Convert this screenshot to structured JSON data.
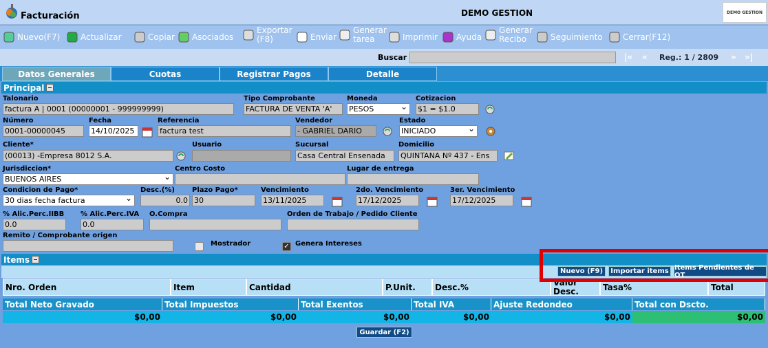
{
  "app": {
    "title": "Facturación",
    "company": "DEMO GESTION",
    "brand_logo_text": "DEMO GESTION"
  },
  "toolbar": [
    {
      "label": "Nuevo(F7)",
      "icon": "new-doc-icon"
    },
    {
      "label": "Actualizar",
      "icon": "refresh-money-icon"
    },
    {
      "label": "Copiar",
      "icon": "copy-icon"
    },
    {
      "label": "Asociados",
      "icon": "associated-icon"
    },
    {
      "label": "Exportar (F8)",
      "icon": "export-icon"
    },
    {
      "label": "Enviar",
      "icon": "send-icon"
    },
    {
      "label": "Generar tarea",
      "icon": "task-icon"
    },
    {
      "label": "Imprimir",
      "icon": "print-icon"
    },
    {
      "label": "Ayuda",
      "icon": "help-icon"
    },
    {
      "label": "Generar Recibo",
      "icon": "receipt-icon"
    },
    {
      "label": "Seguimiento",
      "icon": "tracking-icon"
    },
    {
      "label": "Cerrar(F12)",
      "icon": "close-icon"
    }
  ],
  "search": {
    "label": "Buscar",
    "value": ""
  },
  "pager": {
    "first": "|«",
    "prev": "«",
    "record": "Reg.: 1 / 2809",
    "next": "»",
    "last": "»|"
  },
  "tabs": [
    "Datos Generales",
    "Cuotas",
    "Registrar Pagos",
    "Detalle"
  ],
  "sections": {
    "principal": "Principal",
    "items": "Items"
  },
  "form": {
    "talonario": {
      "label": "Talonario",
      "value": "factura A | 0001 (00000001 - 999999999)"
    },
    "tipo_comprobante": {
      "label": "Tipo Comprobante",
      "value": "FACTURA DE VENTA 'A'"
    },
    "moneda": {
      "label": "Moneda",
      "value": "PESOS"
    },
    "cotizacion": {
      "label": "Cotizacion",
      "value": "$1 = $1.0"
    },
    "numero": {
      "label": "Número",
      "value": "0001-00000045"
    },
    "fecha": {
      "label": "Fecha",
      "value": "14/10/2025"
    },
    "referencia": {
      "label": "Referencia",
      "value": "factura test"
    },
    "vendedor": {
      "label": "Vendedor",
      "value": "- GABRIEL DARIO"
    },
    "estado": {
      "label": "Estado",
      "value": "INICIADO"
    },
    "cliente": {
      "label": "Cliente*",
      "value": "(00013) -Empresa 8012 S.A."
    },
    "usuario": {
      "label": "Usuario",
      "value": ""
    },
    "sucursal": {
      "label": "Sucursal",
      "value": "Casa Central Ensenada"
    },
    "domicilio": {
      "label": "Domicilio",
      "value": "QUINTANA  Nº 437 - Ens"
    },
    "jurisdiccion": {
      "label": "Jurisdiccion*",
      "value": "BUENOS AIRES"
    },
    "centro_costo": {
      "label": "Centro Costo",
      "value": ""
    },
    "lugar_entrega": {
      "label": "Lugar de entrega",
      "value": ""
    },
    "condicion_pago": {
      "label": "Condicion de Pago*",
      "value": "30 dias fecha factura"
    },
    "desc": {
      "label": "Desc.(%)",
      "value": "0.0"
    },
    "plazo_pago": {
      "label": "Plazo Pago*",
      "value": "30"
    },
    "vencimiento": {
      "label": "Vencimiento",
      "value": "13/11/2025"
    },
    "venc2": {
      "label": "2do. Vencimiento",
      "value": "17/12/2025"
    },
    "venc3": {
      "label": "3er. Vencimiento",
      "value": "17/12/2025"
    },
    "alic_iibb": {
      "label": "% Alic.Perc.IIBB",
      "value": "0.0"
    },
    "alic_iva": {
      "label": "% Alic.Perc.IVA",
      "value": "0.0"
    },
    "ocompra": {
      "label": "O.Compra",
      "value": ""
    },
    "orden_trabajo": {
      "label": "Orden de Trabajo / Pedido Cliente",
      "value": ""
    },
    "remito": {
      "label": "Remito / Comprobante origen",
      "value": ""
    },
    "mostrador": {
      "label": "Mostrador",
      "checked": false
    },
    "genera_intereses": {
      "label": "Genera Intereses",
      "checked": true
    }
  },
  "items_buttons": {
    "nuevo": "Nuevo (F9)",
    "importar": "Importar items",
    "pendientes": "Items Pendientes de OT"
  },
  "items_columns": [
    "Nro. Orden",
    "Item",
    "Cantidad",
    "P.Unit.",
    "Desc.%",
    "Valor Desc.",
    "Tasa%",
    "Total"
  ],
  "totals": {
    "headers": [
      "Total Neto Gravado",
      "Total Impuestos",
      "Total Exentos",
      "Total IVA",
      "Ajuste Redondeo",
      "Total con Dscto."
    ],
    "values": [
      "$0,00",
      "$0,00",
      "$0,00",
      "$0,00",
      "$0,00",
      "$0,00"
    ]
  },
  "save_button": "Guardar (F2)"
}
